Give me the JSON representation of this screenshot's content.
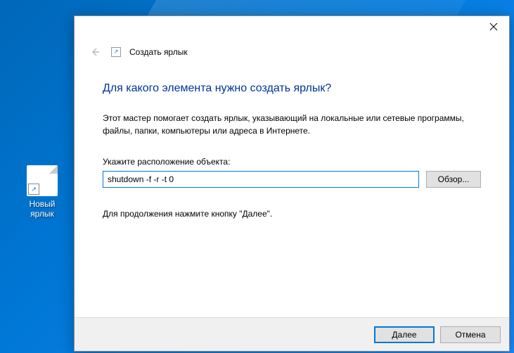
{
  "desktop": {
    "shortcut_label": "Новый\nярлык"
  },
  "dialog": {
    "breadcrumb": "Создать ярлык",
    "heading": "Для какого элемента нужно создать ярлык?",
    "description": "Этот мастер помогает создать ярлык, указывающий на локальные или сетевые программы, файлы, папки, компьютеры или адреса в Интернете.",
    "field_label": "Укажите расположение объекта:",
    "location_value": "shutdown -f -r -t 0",
    "browse_label": "Обзор...",
    "continue_text": "Для продолжения нажмите кнопку \"Далее\".",
    "next_label": "Далее",
    "cancel_label": "Отмена"
  }
}
